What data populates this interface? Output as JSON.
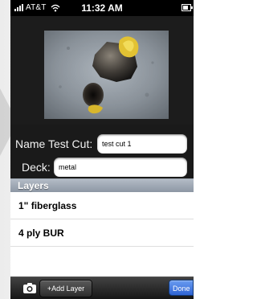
{
  "status_bar": {
    "carrier": "AT&T",
    "time": "11:32 AM",
    "battery_level": 0.8
  },
  "icons": {
    "signal": "signal-bars-icon",
    "wifi": "wifi-icon",
    "battery": "battery-icon",
    "camera": "camera-icon"
  },
  "form": {
    "name_label": "Name Test Cut:",
    "name_value": "test cut 1",
    "deck_label": "Deck:",
    "deck_value": "metal"
  },
  "layers": {
    "header": "Layers",
    "items": [
      "1\" fiberglass",
      "4 ply BUR"
    ]
  },
  "toolbar": {
    "add_layer_label": "+Add Layer",
    "done_label": "Done"
  },
  "colors": {
    "app_background": "#1a1a1a",
    "layers_header": "#9aa3af",
    "done_button": "#3b6fd8"
  }
}
